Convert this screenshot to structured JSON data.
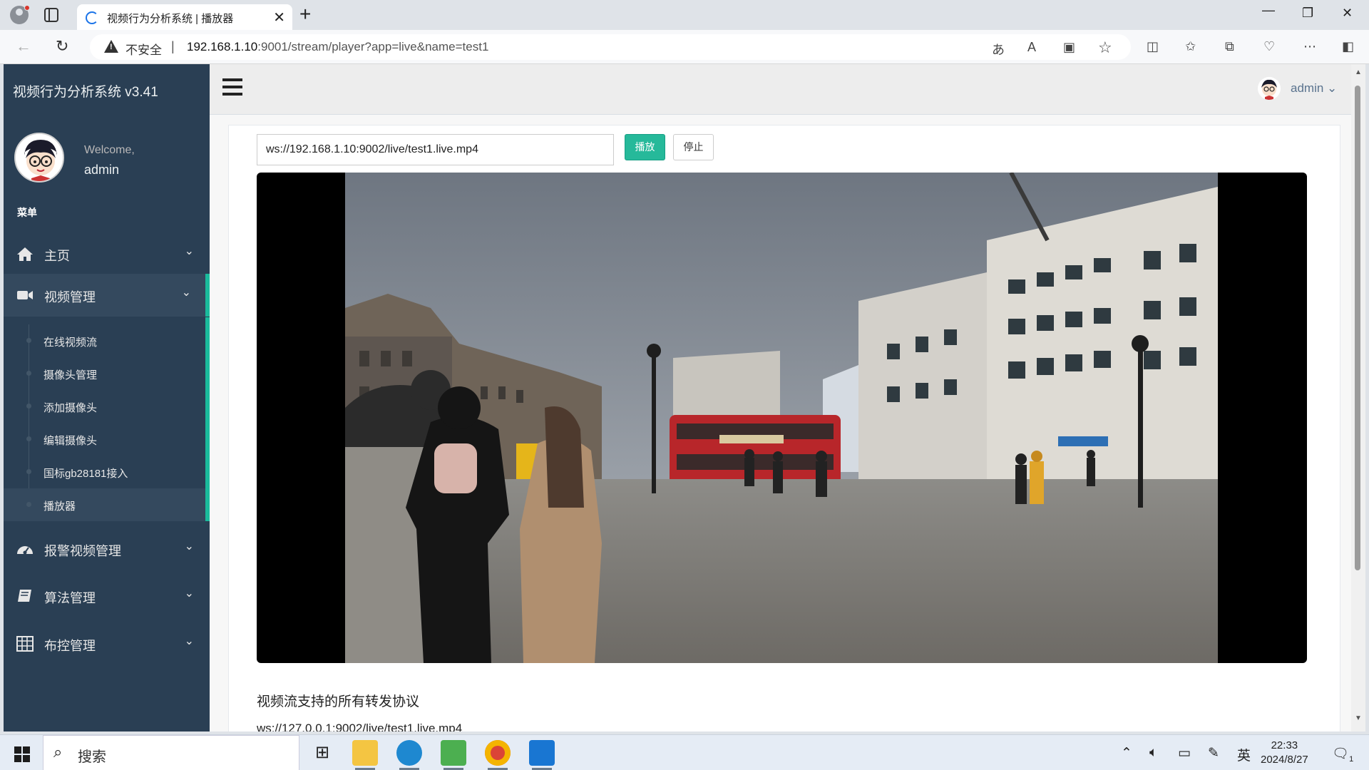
{
  "browser": {
    "tab_title": "视频行为分析系统 | 播放器",
    "tab_close_glyph": "✕",
    "new_tab_glyph": "+",
    "security_label": "不安全",
    "url_host": "192.168.1.10",
    "url_rest": ":9001/stream/player?app=live&name=test1"
  },
  "sidebar": {
    "brand": "视频行为分析系统 v3.41",
    "welcome": "Welcome,",
    "username": "admin",
    "menu_caption": "菜单",
    "menu": [
      {
        "label": "主页",
        "icon": "home-icon"
      },
      {
        "label": "视频管理",
        "icon": "video-camera-icon"
      },
      {
        "label": "报警视频管理",
        "icon": "dashboard-icon"
      },
      {
        "label": "算法管理",
        "icon": "book-icon"
      },
      {
        "label": "布控管理",
        "icon": "table-icon"
      }
    ],
    "submenu": [
      "在线视频流",
      "摄像头管理",
      "添加摄像头",
      "编辑摄像头",
      "国标gb28181接入",
      "播放器"
    ]
  },
  "topnav": {
    "user": "admin"
  },
  "player": {
    "stream_url": "ws://192.168.1.10:9002/live/test1.live.mp4",
    "play_label": "播放",
    "stop_label": "停止",
    "protocols_title": "视频流支持的所有转发协议",
    "protocol_url": "ws://127.0.0.1:9002/live/test1.live.mp4"
  },
  "taskbar": {
    "search_placeholder": "搜索",
    "ime": "英",
    "time": "22:33",
    "date": "2024/8/27",
    "notification_count": "1"
  },
  "colors": {
    "sidebar_bg": "#2a3f54",
    "accent": "#1abb9c",
    "play_button": "#26b99a"
  }
}
